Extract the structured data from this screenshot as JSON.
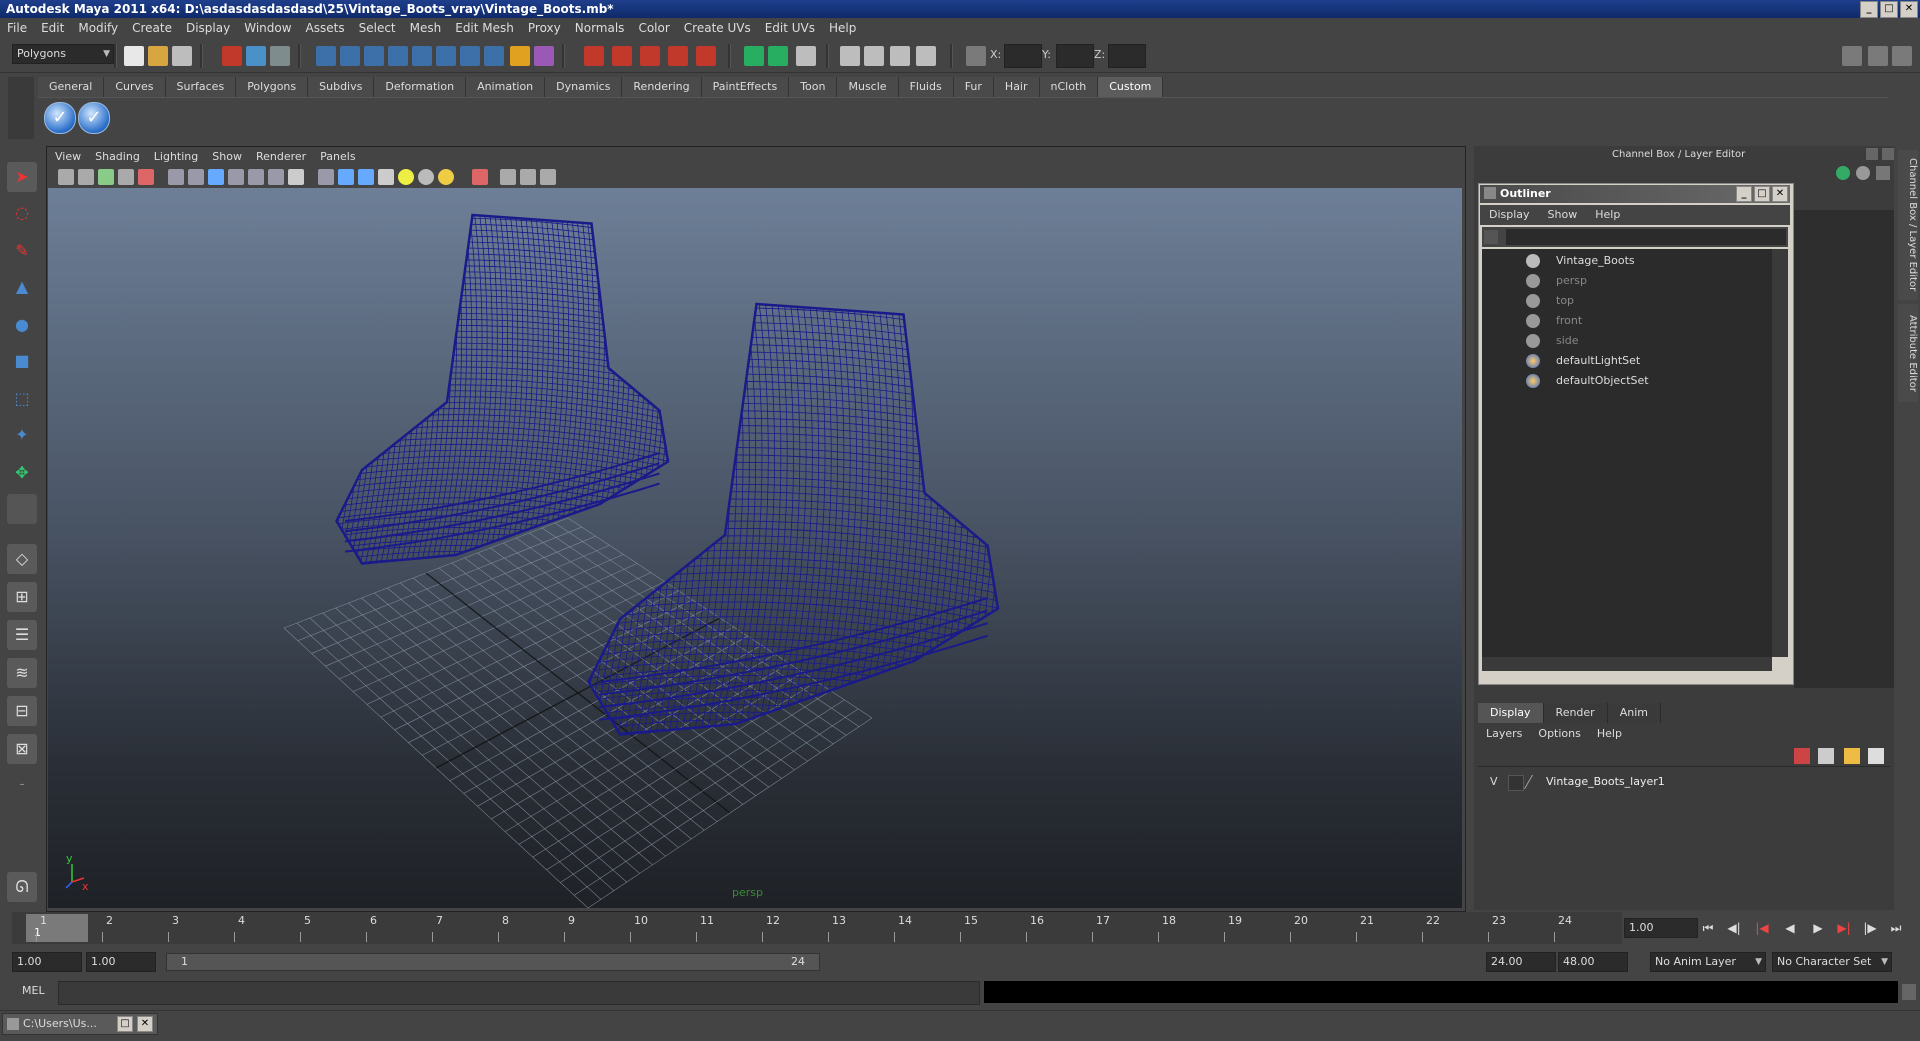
{
  "window": {
    "title": "Autodesk Maya 2011 x64: D:\\asdasdasdasdasd\\25\\Vintage_Boots_vray\\Vintage_Boots.mb*"
  },
  "menubar": [
    "File",
    "Edit",
    "Modify",
    "Create",
    "Display",
    "Window",
    "Assets",
    "Select",
    "Mesh",
    "Edit Mesh",
    "Proxy",
    "Normals",
    "Color",
    "Create UVs",
    "Edit UVs",
    "Help"
  ],
  "status": {
    "mode": "Polygons",
    "x_label": "X:",
    "y_label": "Y:",
    "z_label": "Z:"
  },
  "shelf": {
    "tabs": [
      "General",
      "Curves",
      "Surfaces",
      "Polygons",
      "Subdivs",
      "Deformation",
      "Animation",
      "Dynamics",
      "Rendering",
      "PaintEffects",
      "Toon",
      "Muscle",
      "Fluids",
      "Fur",
      "Hair",
      "nCloth",
      "Custom"
    ],
    "active_tab": "Custom"
  },
  "viewport": {
    "menu": [
      "View",
      "Shading",
      "Lighting",
      "Show",
      "Renderer",
      "Panels"
    ],
    "camera_label": "persp",
    "axis_x": "x",
    "axis_y": "y",
    "wire_color": "#1a1a8a"
  },
  "channel_box": {
    "label": "Channel Box / Layer Editor"
  },
  "outliner": {
    "title": "Outliner",
    "menu": [
      "Display",
      "Show",
      "Help"
    ],
    "items": [
      {
        "name": "Vintage_Boots",
        "dim": false,
        "icon": "transform-icon"
      },
      {
        "name": "persp",
        "dim": true,
        "icon": "camera-icon"
      },
      {
        "name": "top",
        "dim": true,
        "icon": "camera-icon"
      },
      {
        "name": "front",
        "dim": true,
        "icon": "camera-icon"
      },
      {
        "name": "side",
        "dim": true,
        "icon": "camera-icon"
      },
      {
        "name": "defaultLightSet",
        "dim": false,
        "icon": "set-icon"
      },
      {
        "name": "defaultObjectSet",
        "dim": false,
        "icon": "set-icon"
      }
    ]
  },
  "layer_editor": {
    "tabs": [
      "Display",
      "Render",
      "Anim"
    ],
    "active_tab": "Display",
    "menu": [
      "Layers",
      "Options",
      "Help"
    ],
    "layers": [
      {
        "visible": "V",
        "name": "Vintage_Boots_layer1"
      }
    ]
  },
  "side_tabs": [
    "Channel Box / Layer Editor",
    "Attribute Editor"
  ],
  "timeline": {
    "ticks": [
      "1",
      "2",
      "3",
      "4",
      "5",
      "6",
      "7",
      "8",
      "9",
      "10",
      "11",
      "12",
      "13",
      "14",
      "15",
      "16",
      "17",
      "18",
      "19",
      "20",
      "21",
      "22",
      "23",
      "24"
    ],
    "playhead": "1",
    "current_frame": "1.00"
  },
  "range": {
    "start": "1.00",
    "playback_start": "1.00",
    "slider_start": "1",
    "slider_end": "24",
    "playback_end": "24.00",
    "end": "48.00",
    "anim_layer": "No Anim Layer",
    "character_set": "No Character Set"
  },
  "command": {
    "label": "MEL"
  },
  "taskbar": {
    "item": "C:\\Users\\Us..."
  }
}
